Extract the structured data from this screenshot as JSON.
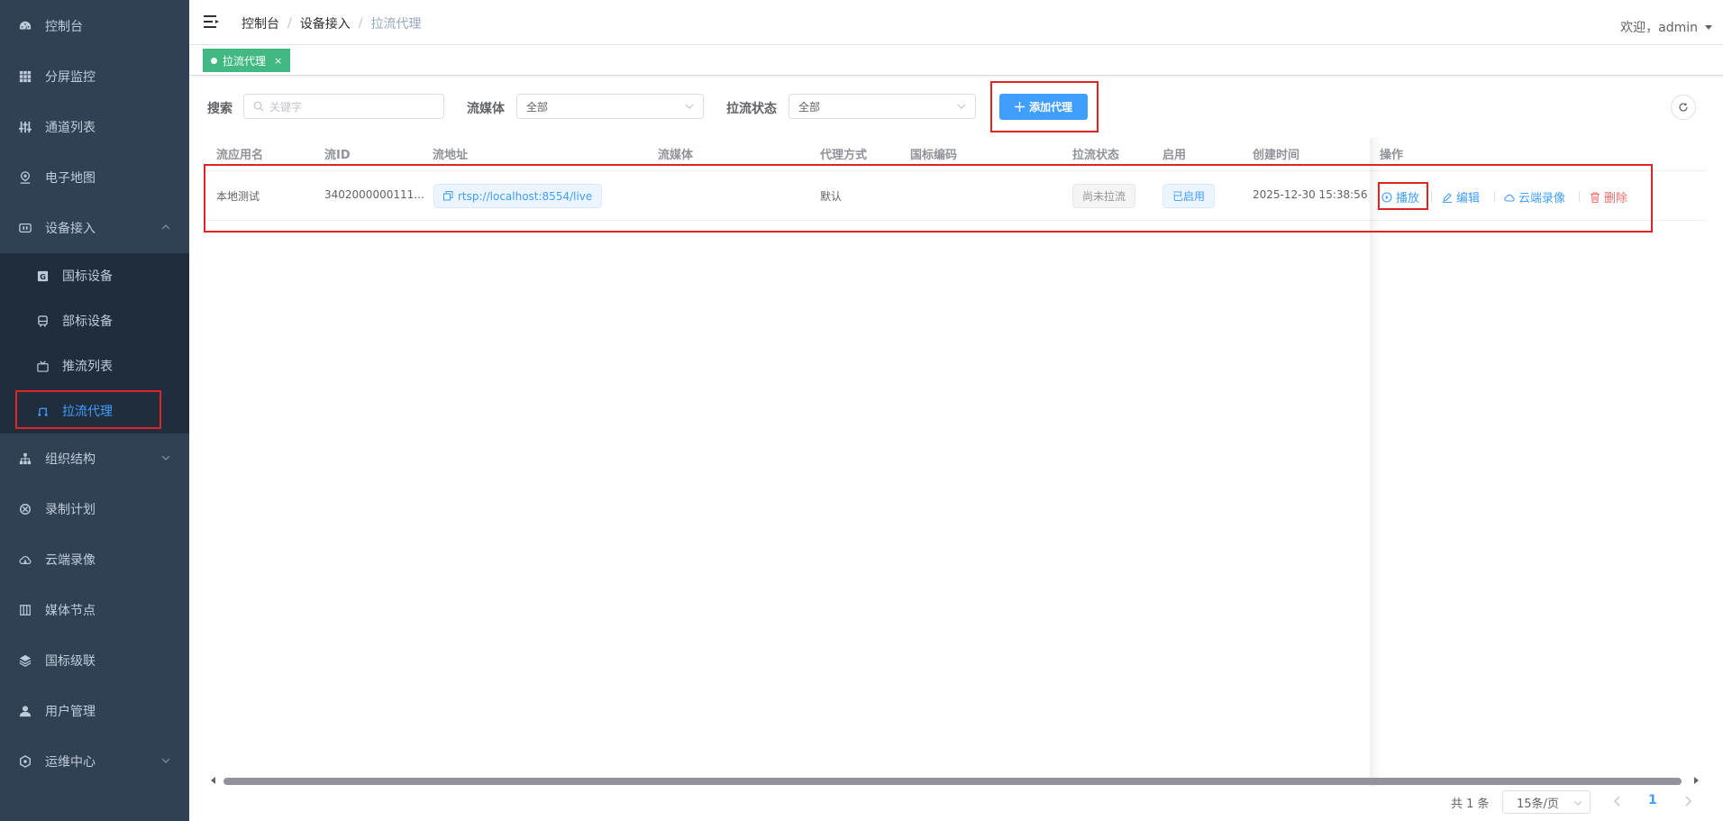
{
  "sidebar": {
    "items": [
      {
        "label": "控制台",
        "icon": "dashboard-icon"
      },
      {
        "label": "分屏监控",
        "icon": "grid-icon"
      },
      {
        "label": "通道列表",
        "icon": "sliders-icon"
      },
      {
        "label": "电子地图",
        "icon": "map-pin-icon"
      },
      {
        "label": "设备接入",
        "icon": "device-icon",
        "expanded": true
      },
      {
        "label": "组织结构",
        "icon": "org-tree-icon"
      },
      {
        "label": "录制计划",
        "icon": "record-plan-icon"
      },
      {
        "label": "云端录像",
        "icon": "cloud-icon"
      },
      {
        "label": "媒体节点",
        "icon": "media-node-icon"
      },
      {
        "label": "国标级联",
        "icon": "layers-icon"
      },
      {
        "label": "用户管理",
        "icon": "user-icon"
      },
      {
        "label": "运维中心",
        "icon": "ops-icon"
      }
    ],
    "submenu": [
      {
        "label": "国标设备",
        "icon": "gb-device-icon"
      },
      {
        "label": "部标设备",
        "icon": "bus-icon"
      },
      {
        "label": "推流列表",
        "icon": "push-stream-icon"
      },
      {
        "label": "拉流代理",
        "icon": "pull-proxy-icon",
        "active": true
      }
    ]
  },
  "navbar": {
    "breadcrumb": [
      "控制台",
      "设备接入",
      "拉流代理"
    ],
    "breadcrumb_sep": "/",
    "welcome": "欢迎，admin"
  },
  "tags": [
    {
      "label": "拉流代理",
      "close": "×"
    }
  ],
  "toolbar": {
    "search_label": "搜索",
    "search_placeholder": "关键字",
    "media_label": "流媒体",
    "media_value": "全部",
    "status_label": "拉流状态",
    "status_value": "全部",
    "add_button": "添加代理"
  },
  "table": {
    "columns": [
      "流应用名",
      "流ID",
      "流地址",
      "流媒体",
      "代理方式",
      "国标编码",
      "拉流状态",
      "启用",
      "创建时间",
      "操作"
    ],
    "rows": [
      {
        "app": "本地测试",
        "stream_id": "3402000000111...",
        "url": "rtsp://localhost:8554/live",
        "media": "",
        "proxy_type": "默认",
        "gb_code": "",
        "pull_status": "尚未拉流",
        "enabled": "已启用",
        "created": "2025-12-30 15:38:56",
        "actions": {
          "play": "播放",
          "edit": "编辑",
          "cloud": "云端录像",
          "delete": "删除"
        }
      }
    ]
  },
  "pagination": {
    "total": "共 1 条",
    "page_size": "15条/页",
    "current_page": "1"
  },
  "colors": {
    "sidebar_bg": "#304156",
    "submenu_bg": "#1f2d3d",
    "primary": "#409eff",
    "tag_green": "#42b983",
    "danger": "#f56c6c",
    "highlight": "#e02424"
  }
}
